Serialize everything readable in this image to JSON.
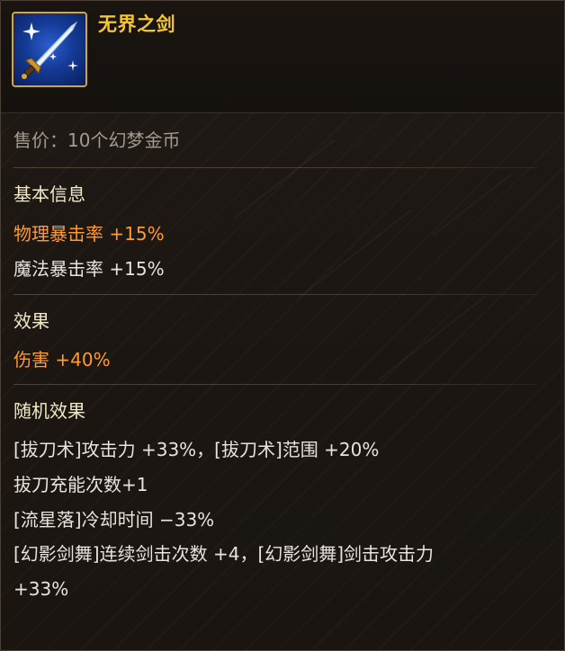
{
  "item": {
    "name": "无界之剑",
    "icon": "sword-icon"
  },
  "price": {
    "label": "售价：10个幻梦金币"
  },
  "basic_info": {
    "heading": "基本信息",
    "stats": [
      {
        "label": "物理暴击率",
        "value": "+15%",
        "highlighted": true
      },
      {
        "label": "魔法暴击率",
        "value": "+15%",
        "highlighted": false
      }
    ]
  },
  "effects": {
    "heading": "效果",
    "stats": [
      {
        "label": "伤害",
        "value": "+40%",
        "highlighted": true
      }
    ]
  },
  "random_effects": {
    "heading": "随机效果",
    "lines": [
      "[拔刀术]攻击力 +33%，[拔刀术]范围 +20%",
      "拔刀充能次数+1",
      "[流星落]冷却时间 −33%",
      "[幻影剑舞]连续剑击次数 +4，[幻影剑舞]剑击攻击力",
      "+33%"
    ]
  },
  "colors": {
    "name_gold": "#f6c533",
    "highlight_orange": "#ff9b2e",
    "icon_border": "#d1a63c",
    "background": "#1c1713"
  }
}
